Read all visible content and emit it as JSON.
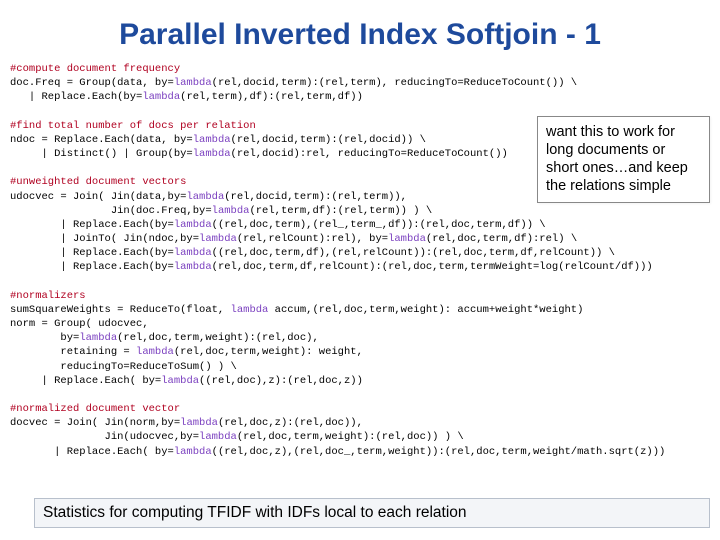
{
  "title": "Parallel Inverted Index Softjoin - 1",
  "callout": "want this to work for long documents or short ones…and keep the relations simple",
  "footer": "Statistics for computing TFIDF with IDFs local to each relation",
  "code": {
    "c1": "#compute document frequency",
    "l1a": "doc.Freq = Group(data, by=",
    "l1b": "(rel,docid,term):(rel,term), reducingTo=ReduceToCount()) \\",
    "l2a": "   | Replace.Each(by=",
    "l2b": "(rel,term),df):(rel,term,df))",
    "c2": "#find total number of docs per relation",
    "l3a": "ndoc = Replace.Each(data, by=",
    "l3b": "(rel,docid,term):(rel,docid)) \\",
    "l4a": "     | Distinct() | Group(by=",
    "l4b": "(rel,docid):rel, reducingTo=ReduceToCount())",
    "c3": "#unweighted document vectors",
    "l5a": "udocvec = Join( Jin(data,by=",
    "l5b": "(rel,docid,term):(rel,term)),",
    "l6a": "                Jin(doc.Freq,by=",
    "l6b": "(rel,term,df):(rel,term)) ) \\",
    "l7a": "        | Replace.Each(by=",
    "l7b": "((rel,doc,term),(rel_,term_,df)):(rel,doc,term,df)) \\",
    "l8a": "        | JoinTo( Jin(ndoc,by=",
    "l8b": "(rel,relCount):rel), by=",
    "l8c": "(rel,doc,term,df):rel) \\",
    "l9a": "        | Replace.Each(by=",
    "l9b": "((rel,doc,term,df),(rel,relCount)):(rel,doc,term,df,relCount)) \\",
    "l10a": "        | Replace.Each(by=",
    "l10b": "(rel,doc,term,df,relCount):(rel,doc,term,termWeight=log(relCount/df)))",
    "c4": "#normalizers",
    "l11a": "sumSquareWeights = ReduceTo(float, ",
    "l11b": " accum,(rel,doc,term,weight): accum+weight*weight)",
    "l12": "norm = Group( udocvec,",
    "l13a": "        by=",
    "l13b": "(rel,doc,term,weight):(rel,doc),",
    "l14a": "        retaining = ",
    "l14b": "(rel,doc,term,weight): weight,",
    "l15": "        reducingTo=ReduceToSum() ) \\",
    "l16a": "     | Replace.Each( by=",
    "l16b": "((rel,doc),z):(rel,doc,z))",
    "c5": "#normalized document vector",
    "l17a": "docvec = Join( Jin(norm,by=",
    "l17b": "(rel,doc,z):(rel,doc)),",
    "l18a": "               Jin(udocvec,by=",
    "l18b": "(rel,doc,term,weight):(rel,doc)) ) \\",
    "l19a": "       | Replace.Each( by=",
    "l19b": "((rel,doc,z),(rel,doc_,term,weight)):(rel,doc,term,weight/math.sqrt(z)))"
  }
}
